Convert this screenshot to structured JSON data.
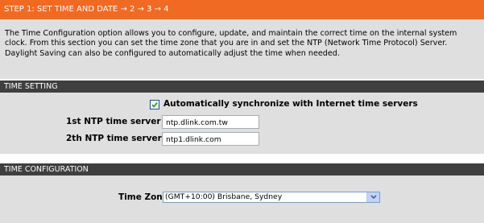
{
  "step": {
    "title": "STEP 1: SET TIME AND DATE",
    "arrows": "→ 2 → 3 → 4",
    "description": "The Time Configuration option allows you to configure, update, and maintain the correct time on the internal system clock. From this section you can set the time zone that you are in and set the NTP (Network Time Protocol) Server. Daylight Saving can also be configured to automatically adjust the time when needed."
  },
  "time_setting": {
    "title": "TIME SETTING",
    "auto_sync_label": "Automatically synchronize with Internet time servers",
    "auto_sync_checked": true,
    "ntp1_label": "1st NTP time server :",
    "ntp1_value": "ntp.dlink.com.tw",
    "ntp2_label": "2th NTP time server :",
    "ntp2_value": "ntp1.dlink.com"
  },
  "time_configuration": {
    "title": "TIME CONFIGURATION",
    "time_zone_label": "Time Zone :",
    "time_zone_value": "(GMT+10:00) Brisbane, Sydney"
  },
  "colors": {
    "step_header": "#f16a23",
    "section_header": "#3f3f3f",
    "panel_background": "#dfdfdf",
    "checkmark": "#21a121"
  }
}
